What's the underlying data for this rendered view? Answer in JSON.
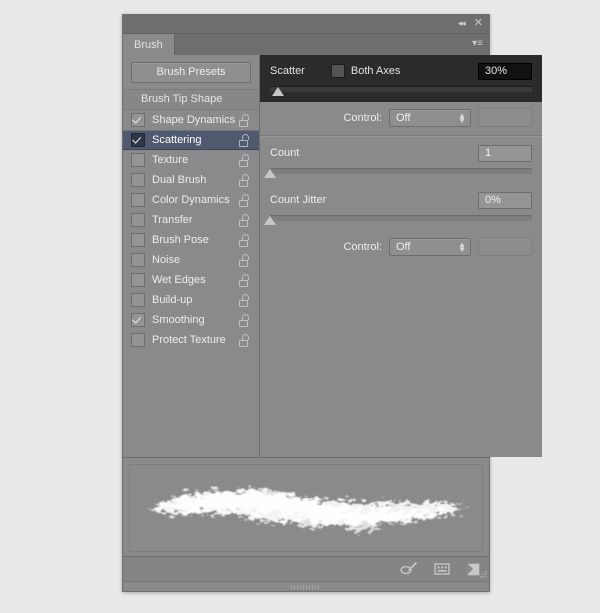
{
  "window": {
    "title": "Brush",
    "collapse_icon": "collapse-double-left-icon",
    "close_icon": "close-icon",
    "menu_icon": "panel-menu-icon"
  },
  "tabs": [
    {
      "label": "Brush",
      "active": true
    }
  ],
  "sidebar": {
    "presets_button": "Brush Presets",
    "section_header": "Brush Tip Shape",
    "items": [
      {
        "label": "Shape Dynamics",
        "checked": true,
        "selected": false,
        "locked": true
      },
      {
        "label": "Scattering",
        "checked": true,
        "selected": true,
        "locked": true
      },
      {
        "label": "Texture",
        "checked": false,
        "selected": false,
        "locked": true
      },
      {
        "label": "Dual Brush",
        "checked": false,
        "selected": false,
        "locked": true
      },
      {
        "label": "Color Dynamics",
        "checked": false,
        "selected": false,
        "locked": true
      },
      {
        "label": "Transfer",
        "checked": false,
        "selected": false,
        "locked": true
      },
      {
        "label": "Brush Pose",
        "checked": false,
        "selected": false,
        "locked": true
      },
      {
        "label": "Noise",
        "checked": false,
        "selected": false,
        "locked": true
      },
      {
        "label": "Wet Edges",
        "checked": false,
        "selected": false,
        "locked": true
      },
      {
        "label": "Build-up",
        "checked": false,
        "selected": false,
        "locked": true
      },
      {
        "label": "Smoothing",
        "checked": true,
        "selected": false,
        "locked": true
      },
      {
        "label": "Protect Texture",
        "checked": false,
        "selected": false,
        "locked": true
      }
    ]
  },
  "options": {
    "scatter": {
      "label": "Scatter",
      "value": "30%",
      "slider_percent": 3,
      "both_axes_label": "Both Axes",
      "both_axes_checked": false,
      "control_label": "Control:",
      "control_value": "Off"
    },
    "count": {
      "label": "Count",
      "value": "1",
      "slider_percent": 0
    },
    "count_jitter": {
      "label": "Count Jitter",
      "value": "0%",
      "slider_percent": 0,
      "control_label": "Control:",
      "control_value": "Off"
    }
  },
  "preview": {
    "name": "brush-stroke-preview"
  },
  "footer": {
    "icons": [
      {
        "name": "toggle-brush-settings-icon"
      },
      {
        "name": "brush-presets-grid-icon"
      },
      {
        "name": "new-brush-preset-icon"
      }
    ],
    "resize_grip": "resize-grip-icon"
  },
  "colors": {
    "panel_bg": "#8a8a8a",
    "titlebar_bg": "#6e6e6e",
    "selection": "#4f5a6e",
    "highlight_group_bg": "#2b2b2b",
    "text": "#ededed"
  }
}
